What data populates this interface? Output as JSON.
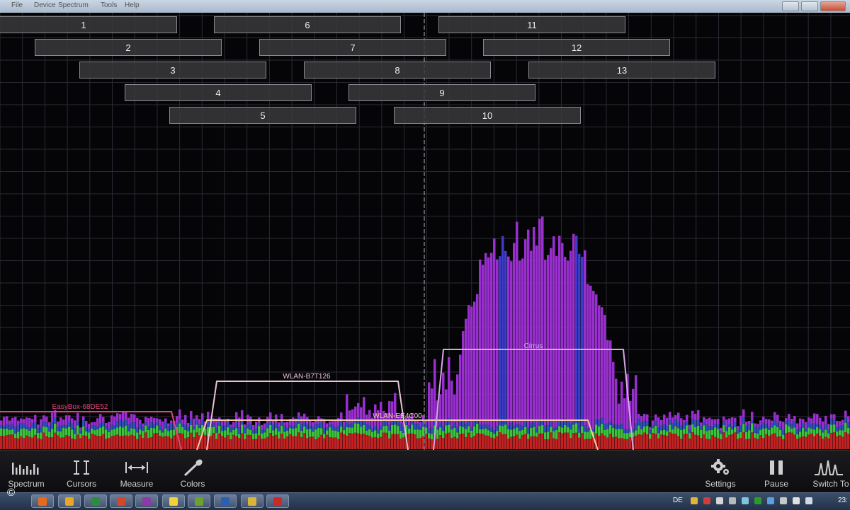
{
  "window": {
    "menu_items": [
      "File",
      "Device",
      "Spectrum",
      "Tools",
      "Help"
    ]
  },
  "channels": [
    "1",
    "2",
    "3",
    "4",
    "5",
    "6",
    "7",
    "8",
    "9",
    "10",
    "11",
    "12",
    "13"
  ],
  "networks": [
    {
      "ssid": "EasyBox-68DE52",
      "color": "#e0457a"
    },
    {
      "ssid": "WLAN-B7T126",
      "color": "#e9c4d4"
    },
    {
      "ssid": "WLAN-EE4C00",
      "color": "#f3c8a8"
    },
    {
      "ssid": "Cirrus",
      "color": "#d8a6e8"
    }
  ],
  "toolbar": {
    "left": [
      {
        "label": "Spectrum",
        "icon": "spectrum-icon"
      },
      {
        "label": "Cursors",
        "icon": "cursors-icon"
      },
      {
        "label": "Measure",
        "icon": "measure-icon"
      },
      {
        "label": "Colors",
        "icon": "colors-icon"
      }
    ],
    "right": [
      {
        "label": "Settings",
        "icon": "gear-icon"
      },
      {
        "label": "Pause",
        "icon": "pause-icon"
      },
      {
        "label": "Switch To",
        "icon": "switch-view-icon"
      }
    ]
  },
  "taskbar": {
    "copyright": "©",
    "language": "DE",
    "clock": "23:",
    "apps": [
      {
        "name": "firefox",
        "color": "#e66a1e"
      },
      {
        "name": "media",
        "color": "#e8a623"
      },
      {
        "name": "excel",
        "color": "#2e8b3f"
      },
      {
        "name": "powerpoint",
        "color": "#d2472b"
      },
      {
        "name": "onenote",
        "color": "#8c3aa6"
      },
      {
        "name": "messenger",
        "color": "#f2d23a"
      },
      {
        "name": "app-green",
        "color": "#6aa22b"
      },
      {
        "name": "word",
        "color": "#2b5fb3"
      },
      {
        "name": "app-yellow",
        "color": "#d8b43a"
      },
      {
        "name": "app-red",
        "color": "#cc2a2a"
      }
    ]
  },
  "colors": {
    "accent_purple": "#9a2fd0",
    "accent_blue": "#3c3cc8",
    "accent_green": "#3cc53c",
    "accent_red": "#c32222"
  }
}
